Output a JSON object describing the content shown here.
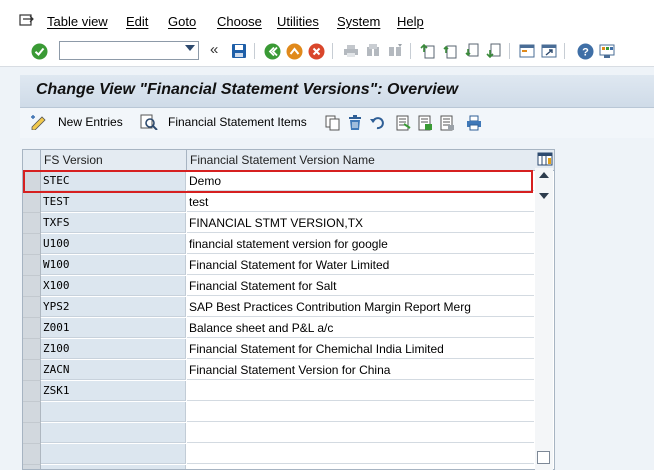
{
  "menubar": {
    "items": [
      {
        "label": "Table view",
        "u": "T"
      },
      {
        "label": "Edit",
        "u": "E"
      },
      {
        "label": "Goto",
        "u": "G"
      },
      {
        "label": "Choose",
        "u": "C"
      },
      {
        "label": "Utilities",
        "u": "U"
      },
      {
        "label": "System",
        "u": "S"
      },
      {
        "label": "Help",
        "u": "H"
      }
    ]
  },
  "toolbar": {
    "command_value": "",
    "chevron": "«"
  },
  "title": "Change View \"Financial Statement Versions\": Overview",
  "apptoolbar": {
    "new_entries": "New Entries",
    "fs_items": "Financial Statement Items"
  },
  "table": {
    "headers": [
      "FS Version",
      "Financial Statement Version Name"
    ],
    "rows": [
      {
        "version": "STEC",
        "name": "Demo"
      },
      {
        "version": "TEST",
        "name": "test"
      },
      {
        "version": "TXFS",
        "name": "FINANCIAL STMT VERSION,TX"
      },
      {
        "version": "U100",
        "name": "financial statement version for google"
      },
      {
        "version": "W100",
        "name": "Financial Statement for Water Limited"
      },
      {
        "version": "X100",
        "name": "Financial Statement for Salt"
      },
      {
        "version": "YPS2",
        "name": "SAP Best Practices Contribution Margin Report Merg"
      },
      {
        "version": "Z001",
        "name": "Balance sheet and P&L a/c"
      },
      {
        "version": "Z100",
        "name": "Financial Statement for Chemichal India Limited"
      },
      {
        "version": "ZACN",
        "name": "Financial Statement Version for China"
      },
      {
        "version": "ZSK1",
        "name": ""
      },
      {
        "version": "",
        "name": ""
      },
      {
        "version": "",
        "name": ""
      },
      {
        "version": "",
        "name": ""
      },
      {
        "version": "",
        "name": ""
      }
    ]
  },
  "colors": {
    "accent_green": "#2e8b2e",
    "highlight_red": "#d62020",
    "save_blue": "#1f5fa8",
    "exit_orange": "#e0891b",
    "cancel_red": "#d9462b"
  }
}
